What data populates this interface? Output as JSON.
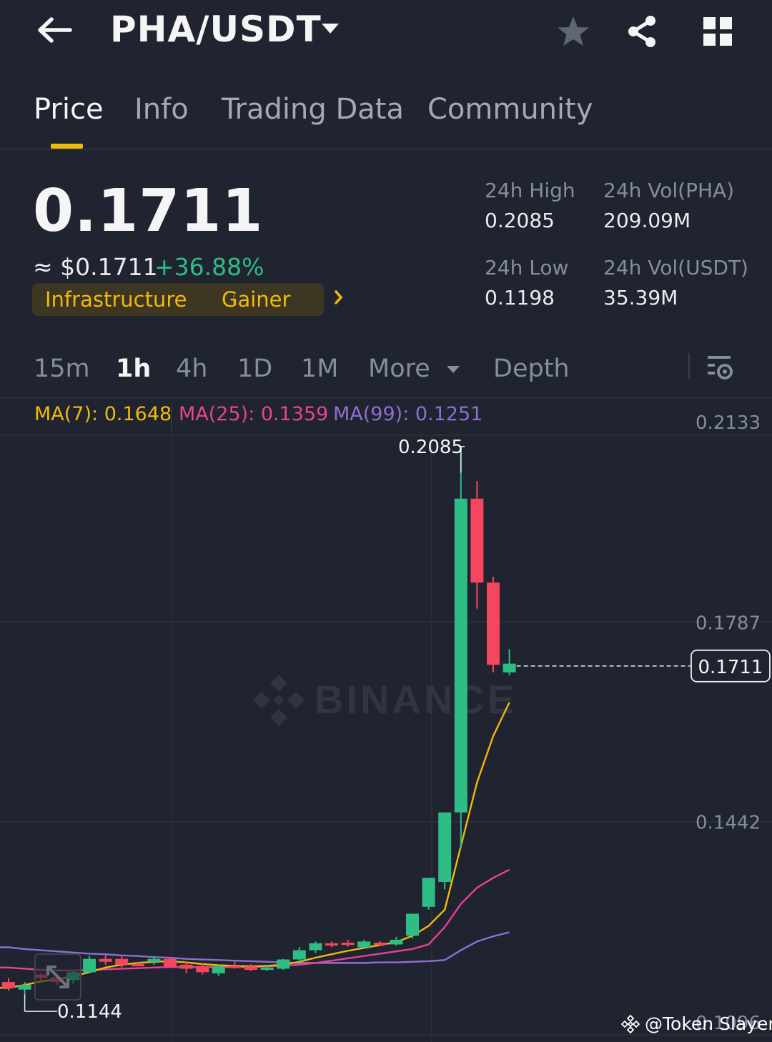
{
  "header": {
    "pair": "PHA/USDT",
    "icons": [
      "back-arrow-icon",
      "caret-down-icon",
      "star-icon",
      "share-icon",
      "grid-icon"
    ]
  },
  "tabs": [
    {
      "label": "Price",
      "active": true
    },
    {
      "label": "Info",
      "active": false
    },
    {
      "label": "Trading Data",
      "active": false
    },
    {
      "label": "Community",
      "active": false
    }
  ],
  "price": {
    "last": "0.1711",
    "usd": "≈ $0.1711",
    "change": "+36.88%",
    "tags": [
      "Infrastructure",
      "Gainer"
    ],
    "colors": {
      "up": "#2ebd85",
      "down": "#f6465d",
      "accent": "#f0b90b"
    }
  },
  "stats": {
    "high_label": "24h High",
    "high_value": "0.2085",
    "low_label": "24h Low",
    "low_value": "0.1198",
    "vol_base_label": "24h Vol(PHA)",
    "vol_base_value": "209.09M",
    "vol_quote_label": "24h Vol(USDT)",
    "vol_quote_value": "35.39M"
  },
  "intervals": {
    "items": [
      "15m",
      "1h",
      "4h",
      "1D",
      "1M"
    ],
    "active": "1h",
    "more": "More",
    "depth": "Depth"
  },
  "ma": {
    "ma7": "MA(7): 0.1648",
    "ma25": "MA(25): 0.1359",
    "ma99": "MA(99): 0.1251",
    "colors": {
      "ma7": "#f0b90b",
      "ma25": "#e84393",
      "ma99": "#8e6fd1"
    }
  },
  "chart_data": {
    "type": "candlestick",
    "y_ticks": [
      "0.2133",
      "0.1787",
      "0.1442",
      "0.1096"
    ],
    "ylim": [
      0.1096,
      0.2133
    ],
    "high_marker": "0.2085",
    "low_marker": "0.1144",
    "last_price_label": "0.1711",
    "watermark": "BINANCE",
    "candles": [
      {
        "o": 0.1165,
        "h": 0.1172,
        "l": 0.115,
        "c": 0.1155
      },
      {
        "o": 0.1152,
        "h": 0.1165,
        "l": 0.1144,
        "c": 0.116
      },
      {
        "o": 0.1178,
        "h": 0.118,
        "l": 0.1168,
        "c": 0.1172
      },
      {
        "o": 0.1173,
        "h": 0.1178,
        "l": 0.116,
        "c": 0.1165
      },
      {
        "o": 0.1168,
        "h": 0.1185,
        "l": 0.1162,
        "c": 0.1182
      },
      {
        "o": 0.1182,
        "h": 0.121,
        "l": 0.118,
        "c": 0.1205
      },
      {
        "o": 0.1205,
        "h": 0.1213,
        "l": 0.1195,
        "c": 0.12
      },
      {
        "o": 0.1205,
        "h": 0.121,
        "l": 0.119,
        "c": 0.1195
      },
      {
        "o": 0.1196,
        "h": 0.12,
        "l": 0.1192,
        "c": 0.1194
      },
      {
        "o": 0.12,
        "h": 0.121,
        "l": 0.1195,
        "c": 0.1205
      },
      {
        "o": 0.1205,
        "h": 0.1208,
        "l": 0.119,
        "c": 0.1192
      },
      {
        "o": 0.1195,
        "h": 0.12,
        "l": 0.118,
        "c": 0.1188
      },
      {
        "o": 0.1192,
        "h": 0.1198,
        "l": 0.1178,
        "c": 0.1182
      },
      {
        "o": 0.118,
        "h": 0.1195,
        "l": 0.1176,
        "c": 0.1192
      },
      {
        "o": 0.1193,
        "h": 0.12,
        "l": 0.1188,
        "c": 0.1192
      },
      {
        "o": 0.1192,
        "h": 0.1196,
        "l": 0.1184,
        "c": 0.1186
      },
      {
        "o": 0.1186,
        "h": 0.1195,
        "l": 0.1184,
        "c": 0.119
      },
      {
        "o": 0.1188,
        "h": 0.1205,
        "l": 0.1186,
        "c": 0.1204
      },
      {
        "o": 0.1204,
        "h": 0.1225,
        "l": 0.12,
        "c": 0.122
      },
      {
        "o": 0.122,
        "h": 0.1235,
        "l": 0.1215,
        "c": 0.1232
      },
      {
        "o": 0.1232,
        "h": 0.1235,
        "l": 0.1225,
        "c": 0.1228
      },
      {
        "o": 0.1233,
        "h": 0.1238,
        "l": 0.1226,
        "c": 0.1229
      },
      {
        "o": 0.1225,
        "h": 0.1238,
        "l": 0.1222,
        "c": 0.1235
      },
      {
        "o": 0.1233,
        "h": 0.1236,
        "l": 0.1228,
        "c": 0.123
      },
      {
        "o": 0.123,
        "h": 0.1243,
        "l": 0.1228,
        "c": 0.1238
      },
      {
        "o": 0.1245,
        "h": 0.126,
        "l": 0.124,
        "c": 0.1283
      },
      {
        "o": 0.1295,
        "h": 0.1315,
        "l": 0.129,
        "c": 0.1345
      },
      {
        "o": 0.1338,
        "h": 0.141,
        "l": 0.1325,
        "c": 0.1458
      },
      {
        "o": 0.1458,
        "h": 0.2085,
        "l": 0.1395,
        "c": 0.2
      },
      {
        "o": 0.2,
        "h": 0.203,
        "l": 0.181,
        "c": 0.1855
      },
      {
        "o": 0.1855,
        "h": 0.1865,
        "l": 0.17,
        "c": 0.1713
      },
      {
        "o": 0.17,
        "h": 0.174,
        "l": 0.1695,
        "c": 0.1715
      }
    ],
    "ma7": [
      0.1155,
      0.116,
      0.1166,
      0.117,
      0.1175,
      0.1182,
      0.119,
      0.1195,
      0.1198,
      0.12,
      0.1201,
      0.1199,
      0.1196,
      0.1194,
      0.1193,
      0.1192,
      0.1193,
      0.1195,
      0.12,
      0.1207,
      0.1213,
      0.1219,
      0.1224,
      0.1229,
      0.1234,
      0.1245,
      0.1262,
      0.129,
      0.14,
      0.151,
      0.159,
      0.1648
    ],
    "ma25": [
      0.119,
      0.1188,
      0.1186,
      0.1185,
      0.1185,
      0.1186,
      0.1187,
      0.1188,
      0.1189,
      0.119,
      0.1191,
      0.1191,
      0.1191,
      0.1191,
      0.1191,
      0.1191,
      0.1192,
      0.1193,
      0.1195,
      0.1198,
      0.1202,
      0.1206,
      0.121,
      0.1214,
      0.1218,
      0.1222,
      0.123,
      0.126,
      0.13,
      0.1328,
      0.1345,
      0.1359
    ],
    "ma99": [
      0.1225,
      0.1222,
      0.122,
      0.1218,
      0.1216,
      0.1214,
      0.1213,
      0.1211,
      0.121,
      0.1208,
      0.1207,
      0.1205,
      0.1204,
      0.1203,
      0.1202,
      0.1201,
      0.12,
      0.1199,
      0.1198,
      0.1198,
      0.1198,
      0.1198,
      0.1198,
      0.1199,
      0.1199,
      0.12,
      0.1201,
      0.1203,
      0.122,
      0.1235,
      0.1244,
      0.1251
    ]
  },
  "credit": "@Token Slayer"
}
